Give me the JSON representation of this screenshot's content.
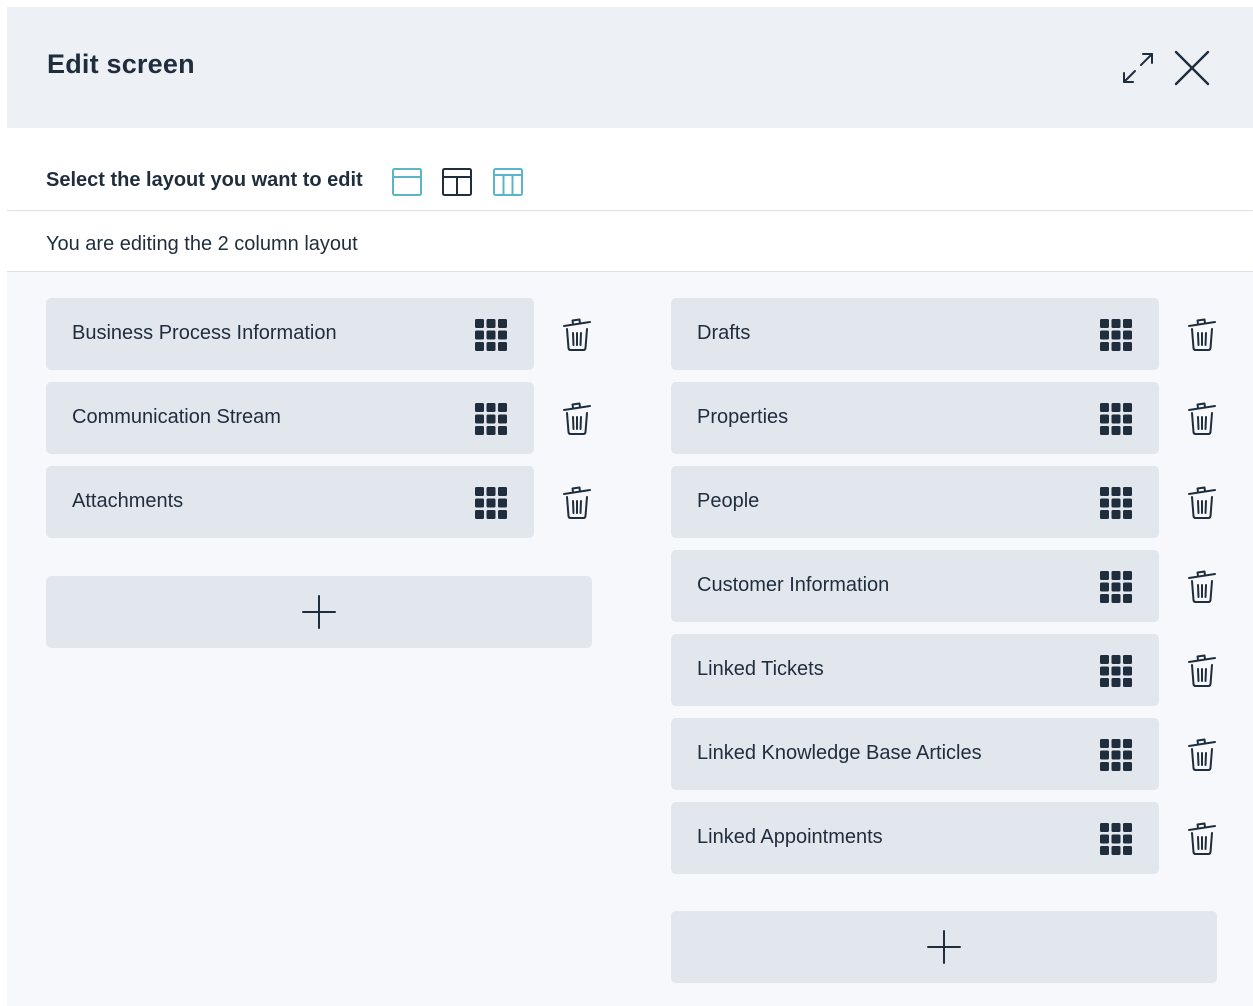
{
  "dialog": {
    "title": "Edit screen",
    "icons": {
      "expand": "expand-arrows-icon",
      "close": "close-icon"
    }
  },
  "layout_select": {
    "label": "Select the layout you want to edit",
    "options": [
      {
        "icon": "layout-one-column-icon",
        "color": "#5bb5c9"
      },
      {
        "icon": "layout-two-column-icon",
        "color": "#1f2d3d"
      },
      {
        "icon": "layout-three-column-icon",
        "color": "#5bb5c9"
      }
    ]
  },
  "editing": {
    "text": "You are editing the 2 column layout"
  },
  "columns": {
    "left": {
      "widgets": [
        {
          "label": "Business Process Information"
        },
        {
          "label": "Communication Stream"
        },
        {
          "label": "Attachments"
        }
      ],
      "add_icon": "plus-icon"
    },
    "right": {
      "widgets": [
        {
          "label": "Drafts"
        },
        {
          "label": "Properties"
        },
        {
          "label": "People"
        },
        {
          "label": "Customer Information"
        },
        {
          "label": "Linked Tickets"
        },
        {
          "label": "Linked Knowledge Base Articles"
        },
        {
          "label": "Linked Appointments"
        }
      ],
      "add_icon": "plus-icon"
    }
  },
  "colors": {
    "header_bg": "#edf0f5",
    "body_bg": "#f6f8fb",
    "widget_bg": "#e2e6ed",
    "text": "#1f2d3d",
    "accent": "#5bb5c9"
  }
}
